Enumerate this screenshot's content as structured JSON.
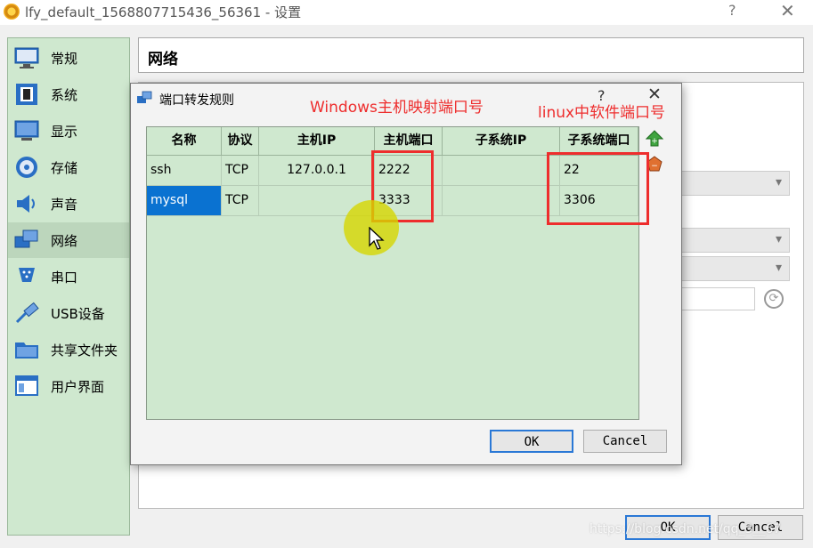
{
  "window": {
    "title": "lfy_default_1568807715436_56361 - 设置",
    "help": "?",
    "close": "✕"
  },
  "sidebar": {
    "items": [
      {
        "label": "常规",
        "icon": "monitor-icon"
      },
      {
        "label": "系统",
        "icon": "chip-icon"
      },
      {
        "label": "显示",
        "icon": "display-icon"
      },
      {
        "label": "存储",
        "icon": "disk-icon"
      },
      {
        "label": "声音",
        "icon": "speaker-icon"
      },
      {
        "label": "网络",
        "icon": "network-icon",
        "active": true
      },
      {
        "label": "串口",
        "icon": "serial-icon"
      },
      {
        "label": "USB设备",
        "icon": "usb-icon"
      },
      {
        "label": "共享文件夹",
        "icon": "folder-icon"
      },
      {
        "label": "用户界面",
        "icon": "ui-icon"
      }
    ]
  },
  "page": {
    "title": "网络"
  },
  "dialog": {
    "title": "端口转发规则",
    "help": "?",
    "close": "✕",
    "columns": [
      "名称",
      "协议",
      "主机IP",
      "主机端口",
      "子系统IP",
      "子系统端口"
    ],
    "rows": [
      {
        "name": "ssh",
        "protocol": "TCP",
        "host_ip": "127.0.0.1",
        "host_port": "2222",
        "guest_ip": "",
        "guest_port": "22"
      },
      {
        "name": "mysql",
        "protocol": "TCP",
        "host_ip": "",
        "host_port": "3333",
        "guest_ip": "",
        "guest_port": "3306",
        "selected_cell": "name"
      }
    ],
    "ok_label": "OK",
    "cancel_label": "Cancel"
  },
  "footer": {
    "ok_label": "OK",
    "cancel_label": "Cancel"
  },
  "annotations": {
    "host_port_label": "Windows主机映射端口号",
    "guest_port_label": "linux中软件端口号",
    "color": "#ee2d2d"
  },
  "watermark": "https://blog.csdn.net/qq_3__67"
}
